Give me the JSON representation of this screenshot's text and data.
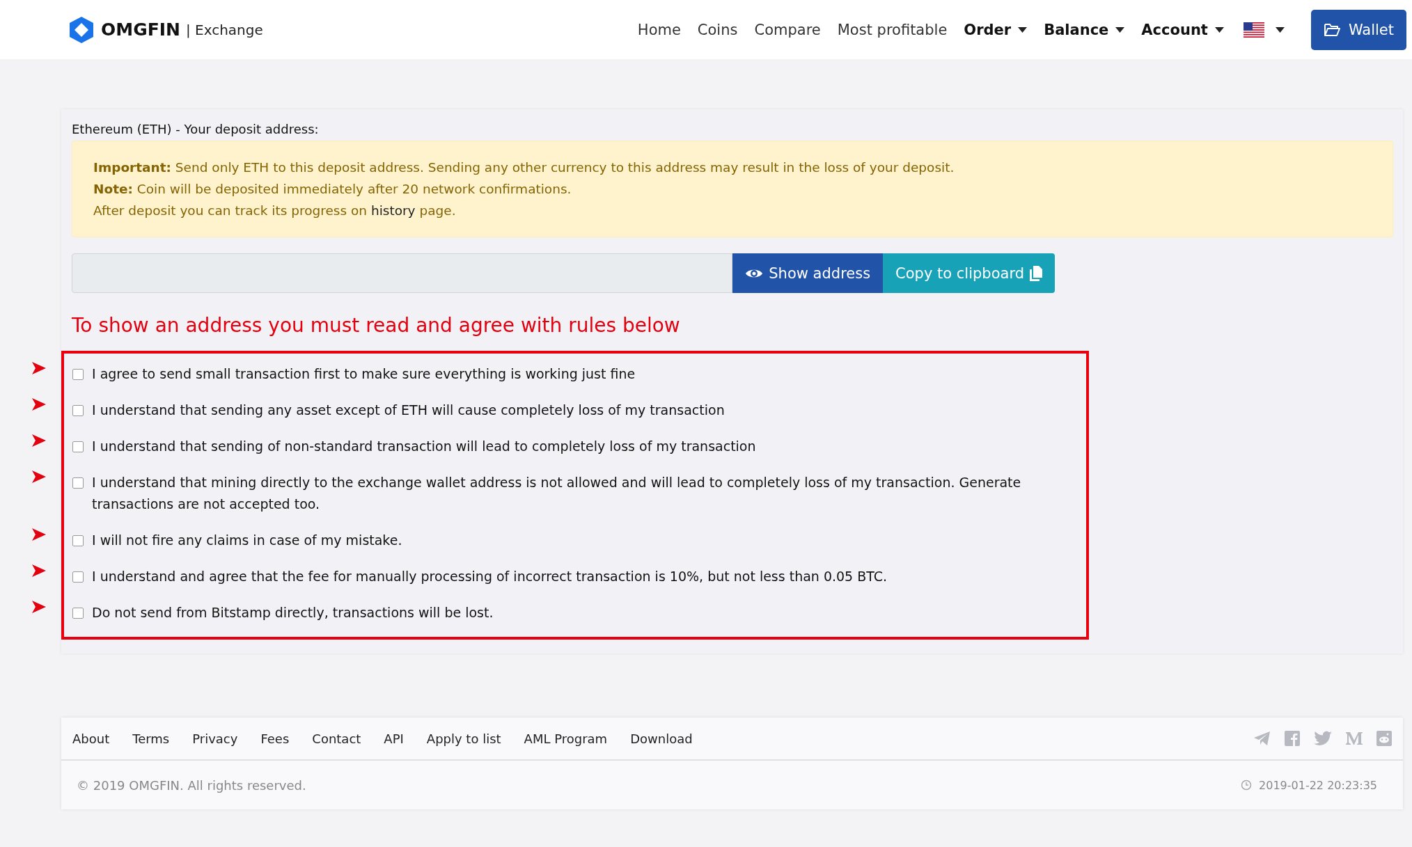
{
  "header": {
    "brand": "OMGFIN",
    "brand_suffix": "| Exchange",
    "nav": [
      {
        "label": "Home",
        "kind": "link"
      },
      {
        "label": "Coins",
        "kind": "link"
      },
      {
        "label": "Compare",
        "kind": "link"
      },
      {
        "label": "Most profitable",
        "kind": "link"
      },
      {
        "label": "Order",
        "kind": "dropdown"
      },
      {
        "label": "Balance",
        "kind": "dropdown"
      },
      {
        "label": "Account",
        "kind": "dropdown"
      }
    ],
    "wallet_button": "Wallet"
  },
  "deposit": {
    "title": "Ethereum (ETH) - Your deposit address:",
    "alert": [
      {
        "kind": "text",
        "text": "**Important:** Send only ETH to this deposit address. Sending any other currency to this address may result in the loss of your deposit."
      },
      {
        "kind": "text",
        "text": "**Note:** Coin will be deposited immediately after 20 network confirmations."
      },
      {
        "kind": "link",
        "before": "After deposit you can track its progress on ",
        "link": "history",
        "after": " page."
      }
    ],
    "show_button": "Show address",
    "copy_button": "Copy to clipboard",
    "warning": "To show an address you must read and agree with rules below",
    "rules": [
      {
        "text": "I agree to send small transaction first to make sure everything is working just fine",
        "checked": false
      },
      {
        "text": "I understand that sending any asset except of ETH will cause completely loss of my transaction",
        "checked": false
      },
      {
        "text": "I understand that sending of non-standard transaction will lead to completely loss of my transaction",
        "checked": false
      },
      {
        "text": "I understand that mining directly to the exchange wallet address is not allowed and will lead to completely loss of my transaction. Generate transactions are not accepted too.",
        "checked": false
      },
      {
        "text": "I will not fire any claims in case of my mistake.",
        "checked": false
      },
      {
        "text": "I understand and agree that the fee for manually processing of incorrect transaction is 10%, but not less than 0.05 BTC.",
        "checked": false
      },
      {
        "text": "Do not send from Bitstamp directly, transactions will be lost.",
        "checked": false
      }
    ]
  },
  "footer": {
    "links": [
      "About",
      "Terms",
      "Privacy",
      "Fees",
      "Contact",
      "API",
      "Apply to list",
      "AML Program",
      "Download"
    ],
    "copyright": "© 2019 OMGFIN. All rights reserved.",
    "timestamp": "2019-01-22 20:23:35"
  }
}
